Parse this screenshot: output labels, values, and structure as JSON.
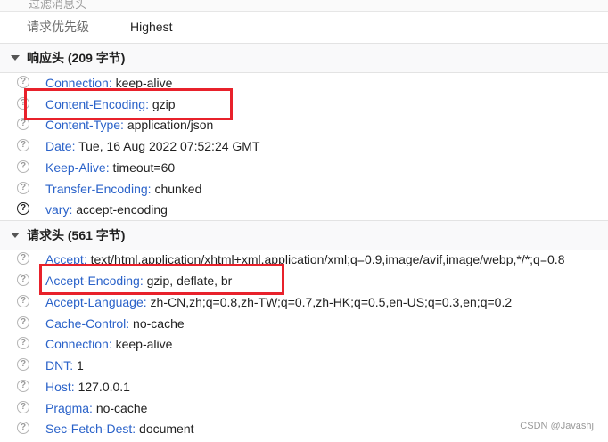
{
  "top": {
    "partial_text": "过滤消息头"
  },
  "priority": {
    "label": "请求优先级",
    "value": "Highest"
  },
  "response": {
    "title": "响应头 (209 字节)",
    "headers": [
      {
        "name": "Connection:",
        "value": "keep-alive"
      },
      {
        "name": "Content-Encoding:",
        "value": "gzip"
      },
      {
        "name": "Content-Type:",
        "value": "application/json"
      },
      {
        "name": "Date:",
        "value": "Tue, 16 Aug 2022 07:52:24 GMT"
      },
      {
        "name": "Keep-Alive:",
        "value": "timeout=60"
      },
      {
        "name": "Transfer-Encoding:",
        "value": "chunked"
      },
      {
        "name": "vary:",
        "value": "accept-encoding"
      }
    ]
  },
  "request": {
    "title": "请求头 (561 字节)",
    "headers": [
      {
        "name": "Accept:",
        "value": "text/html,application/xhtml+xml,application/xml;q=0.9,image/avif,image/webp,*/*;q=0.8"
      },
      {
        "name": "Accept-Encoding:",
        "value": "gzip, deflate, br"
      },
      {
        "name": "Accept-Language:",
        "value": "zh-CN,zh;q=0.8,zh-TW;q=0.7,zh-HK;q=0.5,en-US;q=0.3,en;q=0.2"
      },
      {
        "name": "Cache-Control:",
        "value": "no-cache"
      },
      {
        "name": "Connection:",
        "value": "keep-alive"
      },
      {
        "name": "DNT:",
        "value": "1"
      },
      {
        "name": "Host:",
        "value": "127.0.0.1"
      },
      {
        "name": "Pragma:",
        "value": "no-cache"
      },
      {
        "name": "Sec-Fetch-Dest:",
        "value": "document"
      }
    ]
  },
  "icons": {
    "help": "?"
  },
  "watermark": "CSDN @Javashj",
  "colors": {
    "header_name": "#2a62c9",
    "highlight": "#e8212b"
  }
}
